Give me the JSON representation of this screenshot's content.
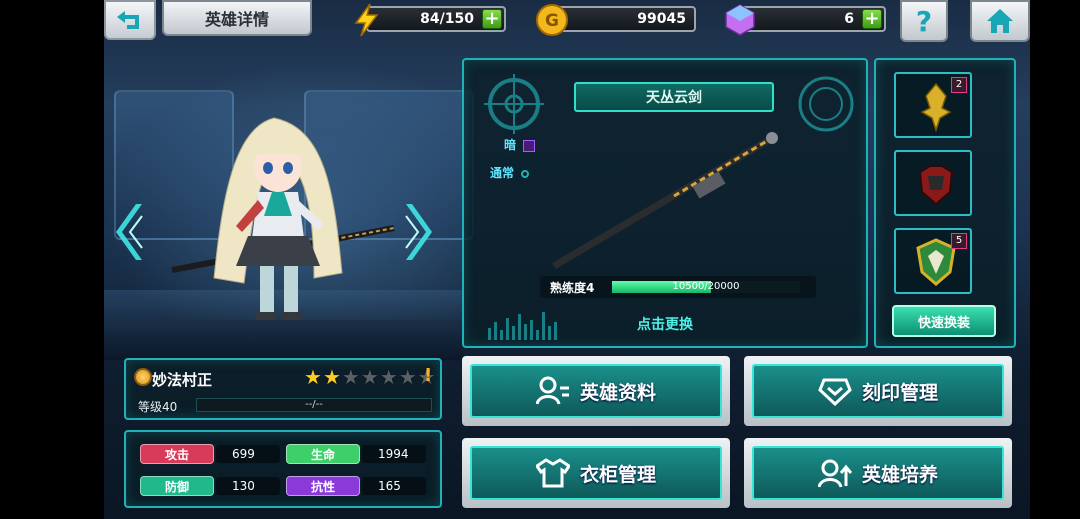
{
  "header": {
    "title": "英雄详情",
    "stamina": "84/150",
    "gold": "99045",
    "gems": "6",
    "help_glyph": "?"
  },
  "hero": {
    "name": "妙法村正",
    "stars_total": 7,
    "stars_filled": 2,
    "warning_glyph": "!",
    "level_label": "等级40",
    "level_bar_text": "--/--",
    "stats": [
      {
        "label": "攻击",
        "value": "699",
        "color": "#d83a5a"
      },
      {
        "label": "生命",
        "value": "1994",
        "color": "#3fcf6a"
      },
      {
        "label": "防御",
        "value": "130",
        "color": "#1fb98c"
      },
      {
        "label": "抗性",
        "value": "165",
        "color": "#8a3ad8"
      }
    ]
  },
  "weapon": {
    "name": "天丛云剑",
    "element_label": "暗",
    "type_label": "通常",
    "proficiency_label": "熟练度4",
    "proficiency_text": "10500/20000",
    "proficiency_fraction": 0.525,
    "change_label": "点击更换"
  },
  "slots": [
    {
      "icon": "golden-crest-icon",
      "badge": "2"
    },
    {
      "icon": "red-armor-icon",
      "badge": ""
    },
    {
      "icon": "shield-emblem-icon",
      "badge": "5"
    }
  ],
  "quick_equip_label": "快速换装",
  "actions": [
    {
      "label": "英雄资料",
      "icon": "profile-icon"
    },
    {
      "label": "刻印管理",
      "icon": "engrave-icon"
    },
    {
      "label": "衣柜管理",
      "icon": "wardrobe-icon"
    },
    {
      "label": "英雄培养",
      "icon": "training-icon"
    }
  ],
  "colors": {
    "accent": "#1fb2b7",
    "panel_border": "#2bbfc3",
    "proficiency_fill": "#2fd880"
  }
}
